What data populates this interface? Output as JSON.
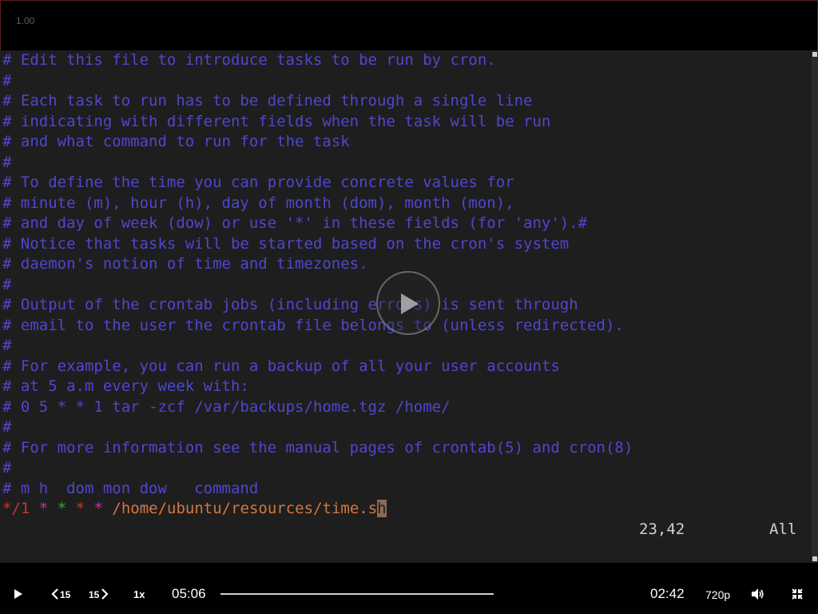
{
  "player": {
    "speed_readout": "1.00",
    "colors": {
      "accent": "#5046d0",
      "background": "#1e1e1e",
      "chrome": "#000000"
    }
  },
  "editor": {
    "comment_lines": [
      "# Edit this file to introduce tasks to be run by cron.",
      "#",
      "# Each task to run has to be defined through a single line",
      "# indicating with different fields when the task will be run",
      "# and what command to run for the task",
      "#",
      "# To define the time you can provide concrete values for",
      "# minute (m), hour (h), day of month (dom), month (mon),",
      "# and day of week (dow) or use '*' in these fields (for 'any').#",
      "# Notice that tasks will be started based on the cron's system",
      "# daemon's notion of time and timezones.",
      "#",
      "# Output of the crontab jobs (including errors) is sent through",
      "# email to the user the crontab file belongs to (unless redirected).",
      "#",
      "# For example, you can run a backup of all your user accounts",
      "# at 5 a.m every week with:",
      "# 0 5 * * 1 tar -zcf /var/backups/home.tgz /home/",
      "#",
      "# For more information see the manual pages of crontab(5) and cron(8)",
      "#",
      "# m h  dom mon dow   command"
    ],
    "cron_entry": {
      "minute": "*/1",
      "hour": "*",
      "dom": "*",
      "month": "*",
      "dow": "*",
      "command": "/home/ubuntu/resources/time.s",
      "cursor_char": "h"
    },
    "status": {
      "position": "23,42",
      "scroll": "All"
    }
  },
  "controls": {
    "rewind_label": "15",
    "forward_label": "15",
    "rate_label": "1x",
    "elapsed": "05:06",
    "remaining": "02:42",
    "quality": "720p",
    "icons": [
      "play-icon",
      "rewind-15-icon",
      "forward-15-icon",
      "volume-icon",
      "exit-fullscreen-icon"
    ]
  }
}
